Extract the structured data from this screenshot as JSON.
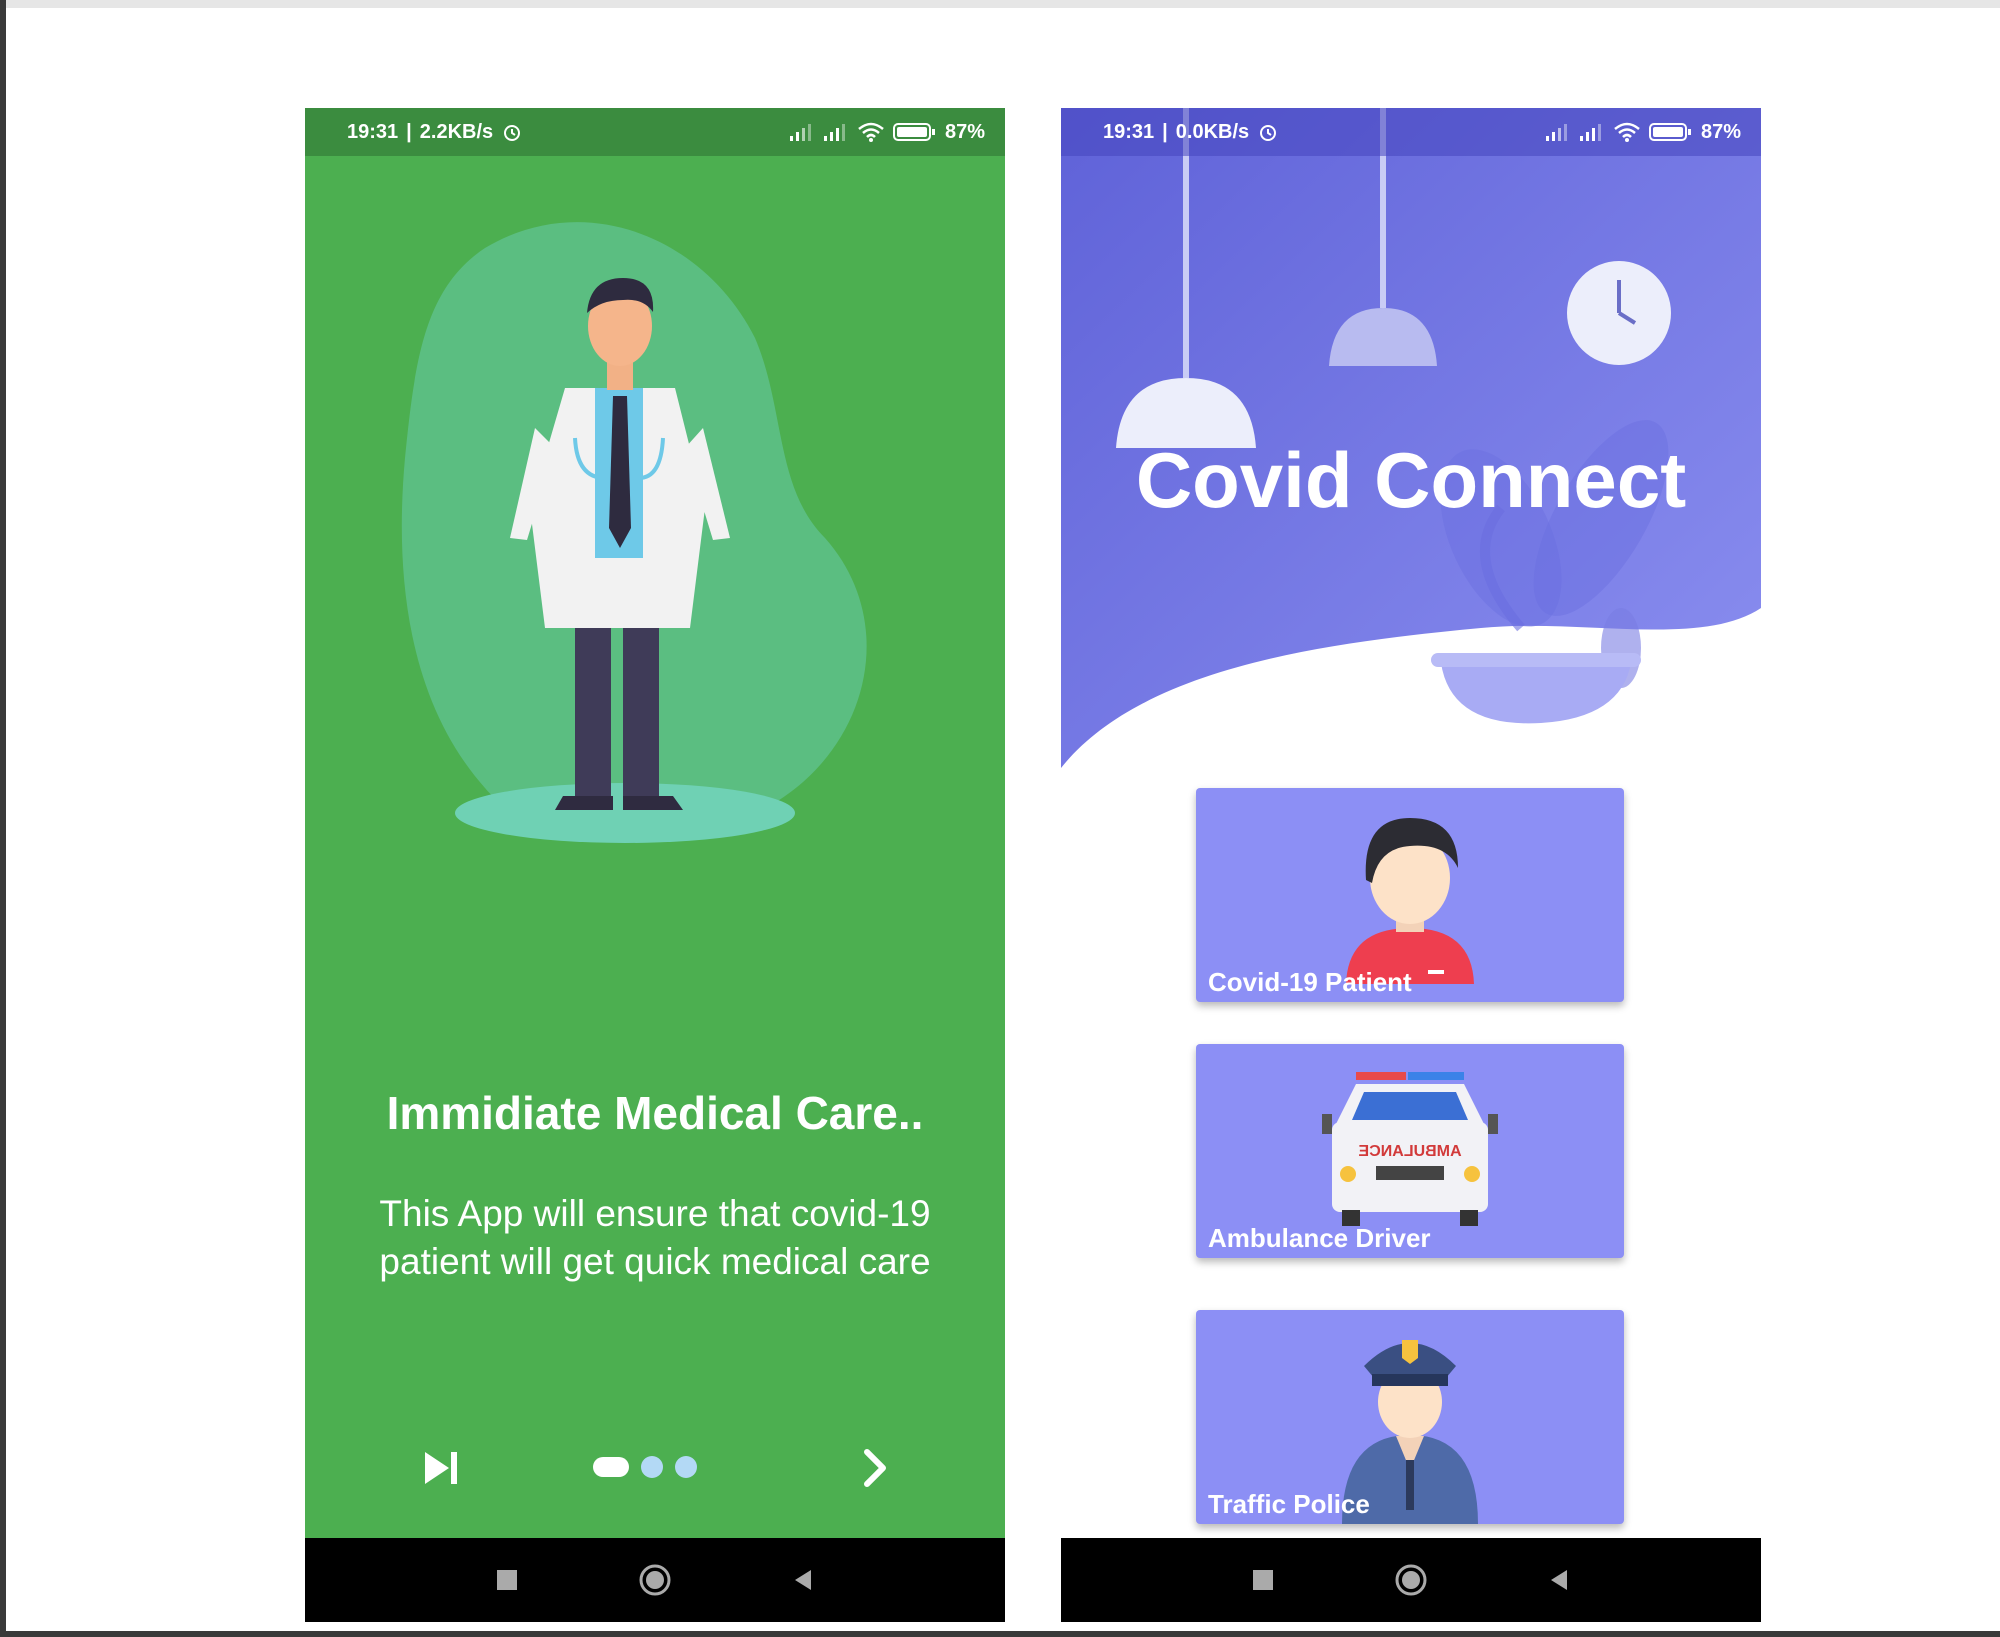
{
  "screens": [
    {
      "status": {
        "time": "19:31",
        "speed": "2.2KB/s",
        "battery": "87"
      },
      "title": "Immidiate Medical Care..",
      "body": "This App will ensure that covid-19 patient will get quick medical care",
      "pager": {
        "dot_count": 3,
        "active_index": 0
      }
    },
    {
      "status": {
        "time": "19:31",
        "speed": "0.0KB/s",
        "battery": "87"
      },
      "app_title": "Covid Connect",
      "cards": [
        {
          "label": "Covid-19 Patient"
        },
        {
          "label": "Ambulance Driver",
          "vehicle_text": "AMBULANCE"
        },
        {
          "label": "Traffic Police"
        }
      ]
    }
  ],
  "colors": {
    "onboarding_bg": "#4caf50",
    "header_gradient": [
      "#5f62d8",
      "#8b8ff0"
    ],
    "card_bg": "#8c8ff5"
  },
  "icons": [
    "skip-icon",
    "next-icon",
    "square-nav-icon",
    "home-nav-icon",
    "back-nav-icon",
    "alarm-icon",
    "signal-icon",
    "wifi-icon",
    "battery-icon"
  ]
}
